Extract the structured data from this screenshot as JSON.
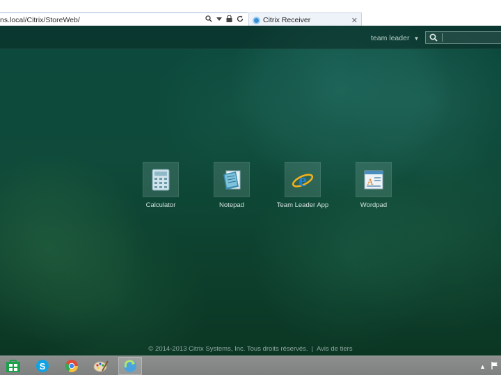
{
  "browser": {
    "address": "ns.local/Citrix/StoreWeb/",
    "tab_title": "Citrix Receiver",
    "icons": [
      "search-icon",
      "dropdown-icon",
      "lock-icon",
      "refresh-icon",
      "close-icon"
    ]
  },
  "header": {
    "user": "team leader",
    "search_placeholder": ""
  },
  "apps": [
    {
      "label": "Calculator",
      "icon": "calculator-icon"
    },
    {
      "label": "Notepad",
      "icon": "notepad-icon"
    },
    {
      "label": "Team Leader App",
      "icon": "internet-explorer-icon"
    },
    {
      "label": "Wordpad",
      "icon": "wordpad-icon"
    }
  ],
  "footer": {
    "copyright": "© 2014-2013 Citrix Systems, Inc. Tous droits réservés.",
    "separator": "|",
    "link": "Avis de tiers"
  },
  "taskbar": {
    "items": [
      "store-icon",
      "skype-icon",
      "chrome-icon",
      "paint-icon",
      "citrix-receiver-icon"
    ],
    "tray": [
      "show-hidden-icons",
      "action-center-flag-icon"
    ]
  },
  "colors": {
    "background": "#0d3f2c",
    "taskbar": "#858787",
    "text": "#d3e2dd"
  }
}
